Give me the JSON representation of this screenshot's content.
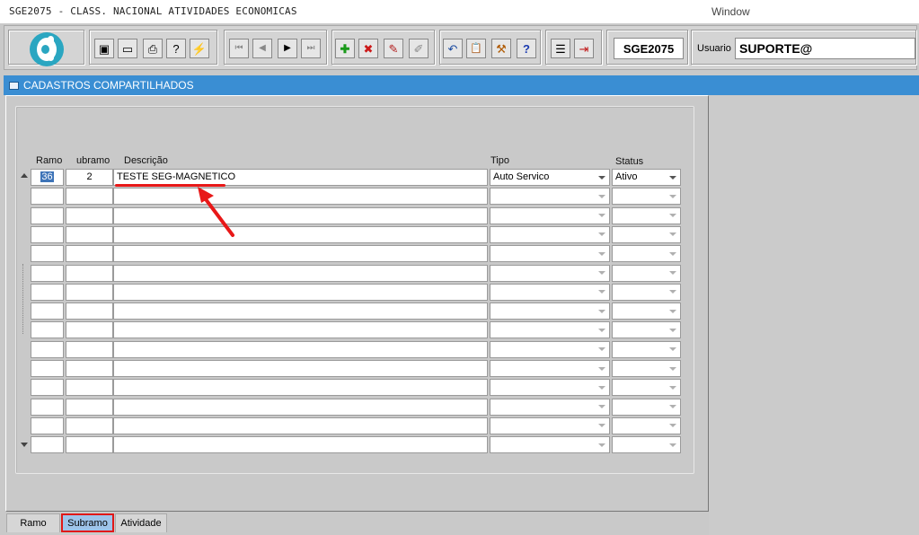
{
  "app": {
    "title": "SGE2075 - CLASS. NACIONAL ATIVIDADES ECONOMICAS",
    "window_menu": "Window"
  },
  "toolbar": {
    "form_code": "SGE2075",
    "user_label": "Usuario",
    "user_value": "SUPORTE@",
    "buttons": [
      {
        "name": "save-icon",
        "glyph": "▣"
      },
      {
        "name": "window-icon",
        "glyph": "▭"
      },
      {
        "name": "print-icon",
        "glyph": "⎙"
      },
      {
        "name": "query-help-icon",
        "glyph": "?"
      },
      {
        "name": "execute-query-icon",
        "glyph": "⚡"
      },
      {
        "name": "first-record-icon",
        "glyph": "⏮"
      },
      {
        "name": "previous-record-icon",
        "glyph": "◀"
      },
      {
        "name": "next-record-icon",
        "glyph": "▶"
      },
      {
        "name": "last-record-icon",
        "glyph": "⏭"
      },
      {
        "name": "insert-record-icon",
        "glyph": "✚"
      },
      {
        "name": "delete-record-icon",
        "glyph": "✖"
      },
      {
        "name": "edit-record-icon",
        "glyph": "✎"
      },
      {
        "name": "clear-icon",
        "glyph": "✐"
      },
      {
        "name": "undo-icon",
        "glyph": "↶"
      },
      {
        "name": "clipboard-icon",
        "glyph": "📋"
      },
      {
        "name": "tools-icon",
        "glyph": "⚒"
      },
      {
        "name": "help-icon",
        "glyph": "?"
      },
      {
        "name": "menu-icon",
        "glyph": "☰"
      },
      {
        "name": "exit-icon",
        "glyph": "⇥"
      }
    ]
  },
  "window": {
    "title": "CADASTROS COMPARTILHADOS"
  },
  "grid": {
    "headers": {
      "ramo": "Ramo",
      "subramo": "ubramo",
      "descricao": "Descrição",
      "tipo": "Tipo",
      "status": "Status"
    },
    "rows": [
      {
        "ramo": "36",
        "subramo": "2",
        "descricao": "TESTE SEG-MAGNETICO",
        "tipo": "Auto Servico",
        "status": "Ativo"
      }
    ],
    "empty_rows": 14
  },
  "tabs": [
    "Ramo",
    "Subramo",
    "Atividade"
  ],
  "active_tab": "Subramo"
}
